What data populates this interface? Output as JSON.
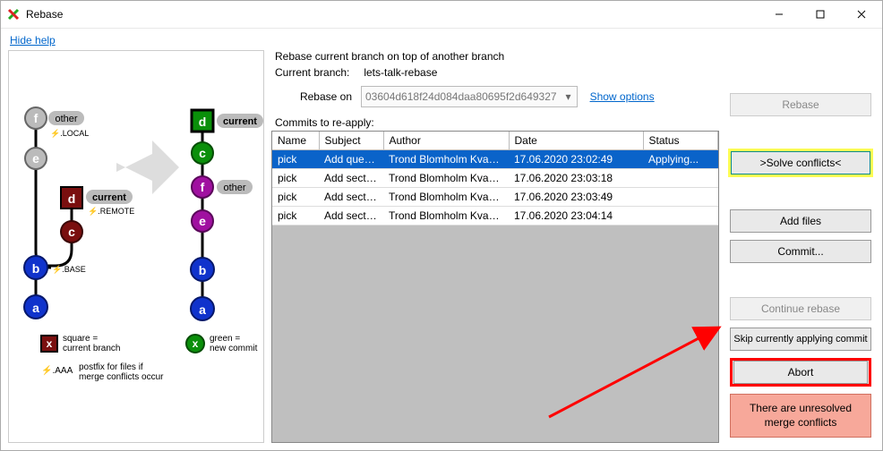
{
  "window": {
    "title": "Rebase"
  },
  "link_hide_help": "Hide help",
  "header": {
    "line1": "Rebase current branch on top of another branch",
    "current_branch_lbl": "Current branch:",
    "current_branch_val": "lets-talk-rebase",
    "rebase_on_lbl": "Rebase on",
    "rebase_on_val": "03604d618f24d084daa80695f2d649327",
    "show_options": "Show options",
    "commits_lbl": "Commits to re-apply:"
  },
  "table": {
    "cols": [
      "Name",
      "Subject",
      "Author",
      "Date",
      "Status"
    ],
    "rows": [
      {
        "name": "pick",
        "subject": "Add quest...",
        "author": "Trond Blomholm Kvamme...",
        "date": "17.06.2020 23:02:49",
        "status": "Applying..."
      },
      {
        "name": "pick",
        "subject": "Add sectio...",
        "author": "Trond Blomholm Kvamme...",
        "date": "17.06.2020 23:03:18",
        "status": ""
      },
      {
        "name": "pick",
        "subject": "Add sectio...",
        "author": "Trond Blomholm Kvamme...",
        "date": "17.06.2020 23:03:49",
        "status": ""
      },
      {
        "name": "pick",
        "subject": "Add sectio...",
        "author": "Trond Blomholm Kvamme...",
        "date": "17.06.2020 23:04:14",
        "status": ""
      }
    ]
  },
  "buttons": {
    "rebase": "Rebase",
    "solve": ">Solve conflicts<",
    "add_files": "Add files",
    "commit": "Commit...",
    "continue": "Continue rebase",
    "skip": "Skip currently applying commit",
    "abort": "Abort"
  },
  "warning": "There are unresolved merge conflicts",
  "diagram": {
    "left_branch_labels": {
      "other": "other",
      "local": "⚡.LOCAL",
      "current": "current",
      "remote": "⚡.REMOTE",
      "base": "⚡.BASE"
    },
    "right_branch_labels": {
      "current": "current",
      "other": "other"
    },
    "legend": {
      "square": "square =\ncurrent branch",
      "green": "green =\nnew commit",
      "aaa": "postfix for files if\nmerge conflicts occur",
      "aaa_lbl": "⚡.AAA"
    }
  }
}
